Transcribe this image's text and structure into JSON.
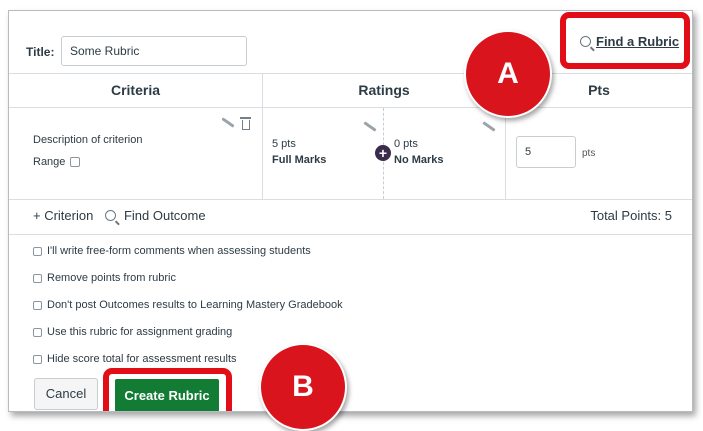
{
  "title_field": {
    "label": "Title:",
    "value": "Some Rubric"
  },
  "find_rubric_label": "Find a Rubric",
  "table": {
    "headers": {
      "criteria": "Criteria",
      "ratings": "Ratings",
      "pts": "Pts"
    },
    "criterion": {
      "description": "Description of criterion",
      "range_label": "Range",
      "ratings": [
        {
          "points": "5 pts",
          "label": "Full Marks"
        },
        {
          "points": "0 pts",
          "label": "No Marks"
        }
      ],
      "points_value": "5",
      "points_unit": "pts"
    }
  },
  "footer": {
    "add_criterion": "+ Criterion",
    "find_outcome": "Find Outcome",
    "total_points": "Total Points: 5"
  },
  "options": [
    "I'll write free-form comments when assessing students",
    "Remove points from rubric",
    "Don't post Outcomes results to Learning Mastery Gradebook",
    "Use this rubric for assignment grading",
    "Hide score total for assessment results"
  ],
  "buttons": {
    "cancel": "Cancel",
    "create": "Create Rubric"
  },
  "callouts": {
    "a": "A",
    "b": "B"
  },
  "colors": {
    "callout_red": "#e10d17",
    "create_green": "#127c35",
    "text": "#2d3b45"
  }
}
